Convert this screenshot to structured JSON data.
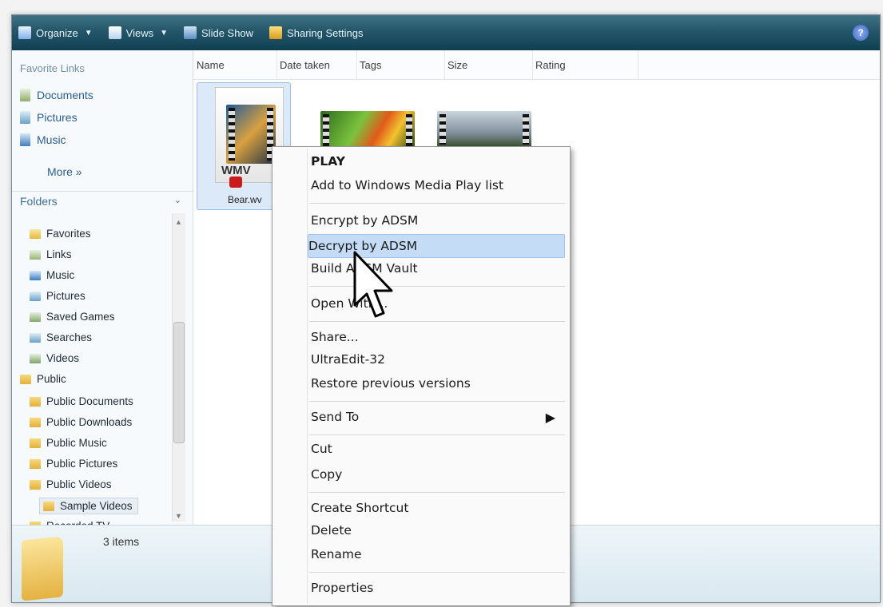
{
  "toolbar": {
    "organize": "Organize",
    "views": "Views",
    "slideshow": "Slide Show",
    "sharing": "Sharing Settings",
    "help": "?"
  },
  "nav": {
    "favorite_title": "Favorite Links",
    "favorites": [
      "Documents",
      "Pictures",
      "Music"
    ],
    "more": "More »",
    "folders_label": "Folders",
    "folders_chevron": "⌄",
    "tree": [
      "Favorites",
      "Links",
      "Music",
      "Pictures",
      "Saved Games",
      "Searches",
      "Videos",
      "Public",
      "Public Documents",
      "Public Downloads",
      "Public Music",
      "Public Pictures",
      "Public Videos",
      "Sample Videos",
      "Recorded TV"
    ]
  },
  "columns": [
    "Name",
    "Date taken",
    "Tags",
    "Size",
    "Rating"
  ],
  "files": {
    "first_label": "Bear.wv",
    "badge": "WMV"
  },
  "status": {
    "count": "3 items"
  },
  "context_menu": {
    "items": [
      "PLAY",
      "Add to Windows Media Play list",
      "Encrypt by ADSM",
      "Decrypt by ADSM",
      "Build ADSM Vault",
      "Open With...",
      "Share...",
      "UltraEdit-32",
      "Restore previous versions",
      "Send To",
      "Cut",
      "Copy",
      "Create Shortcut",
      "Delete",
      "Rename",
      "Properties"
    ],
    "submenu_arrow": "▶",
    "highlighted_index": 3
  },
  "colors": {
    "toolbar": "#24566a",
    "highlight": "#c4dcf6",
    "link": "#2b5d8c"
  }
}
